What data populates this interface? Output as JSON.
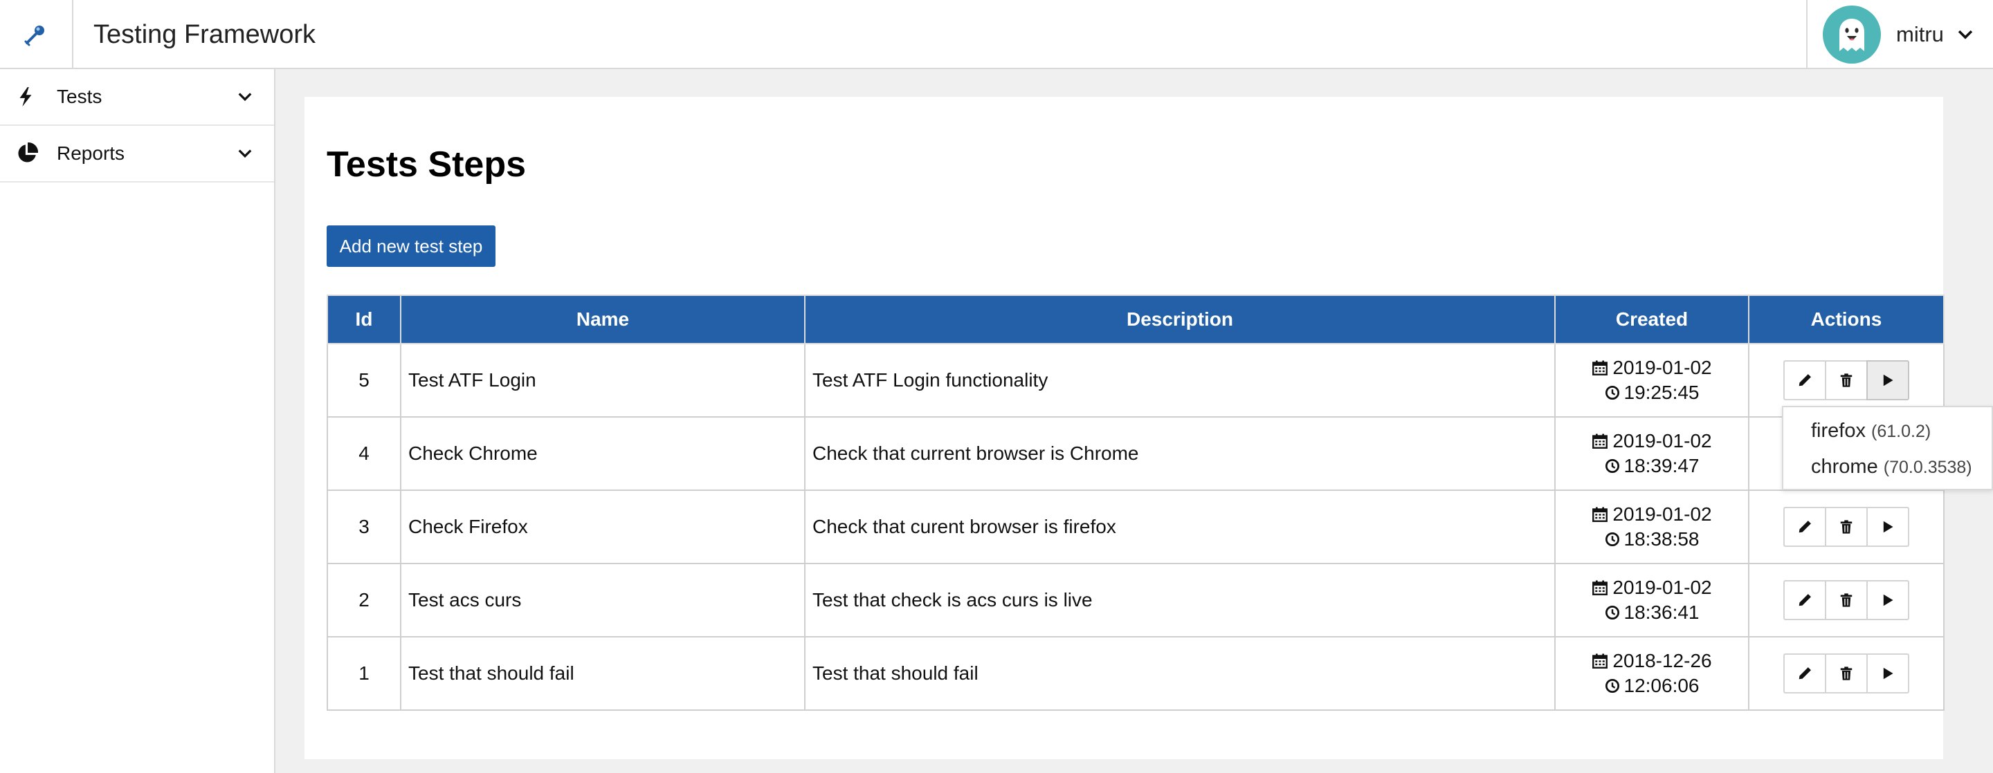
{
  "header": {
    "app_title": "Testing Framework",
    "user_name": "mitru"
  },
  "sidebar": {
    "items": [
      {
        "label": "Tests",
        "icon": "bolt-icon"
      },
      {
        "label": "Reports",
        "icon": "pie-chart-icon"
      }
    ]
  },
  "main": {
    "page_title": "Tests Steps",
    "add_button_label": "Add new test step",
    "table": {
      "columns": [
        "Id",
        "Name",
        "Description",
        "Created",
        "Actions"
      ],
      "rows": [
        {
          "id": "5",
          "name": "Test ATF Login",
          "description": "Test ATF Login functionality",
          "date": "2019-01-02",
          "time": "19:25:45"
        },
        {
          "id": "4",
          "name": "Check Chrome",
          "description": "Check that current browser is Chrome",
          "date": "2019-01-02",
          "time": "18:39:47"
        },
        {
          "id": "3",
          "name": "Check Firefox",
          "description": "Check that curent browser is firefox",
          "date": "2019-01-02",
          "time": "18:38:58"
        },
        {
          "id": "2",
          "name": "Test acs curs",
          "description": "Test that check is acs curs is live",
          "date": "2019-01-02",
          "time": "18:36:41"
        },
        {
          "id": "1",
          "name": "Test that should fail",
          "description": "Test that should fail",
          "date": "2018-12-26",
          "time": "12:06:06"
        }
      ]
    }
  },
  "browser_dropdown": {
    "items": [
      {
        "name": "firefox",
        "version": "(61.0.2)"
      },
      {
        "name": "chrome",
        "version": "(70.0.3538)"
      }
    ]
  },
  "colors": {
    "header_blue": "#2360a8",
    "button_blue": "#1f5faa",
    "avatar_teal": "#4fb7b8"
  }
}
